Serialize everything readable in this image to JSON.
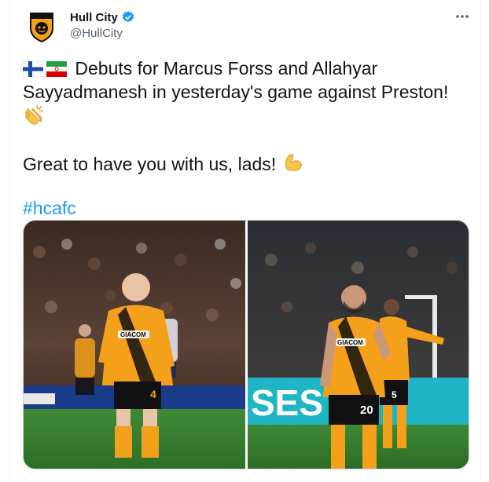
{
  "tweet": {
    "display_name": "Hull City",
    "handle": "@HullCity",
    "verified": true,
    "line1": " Debuts for Marcus Forss and Allahyar",
    "line2": "Sayyadmanesh in yesterday's game against Preston!",
    "line3": "Great to have you with us, lads! ",
    "hashtag": "#hcafc",
    "flags": [
      "flag-finland-icon",
      "flag-iran-icon"
    ],
    "emojis": [
      "clapping-hands-icon",
      "flexed-biceps-icon"
    ]
  },
  "media": {
    "photos": [
      {
        "shirt_sponsor": "GIACOM",
        "shirt_number": "4"
      },
      {
        "shirt_sponsor": "GIACOM",
        "shirt_number": "20",
        "background_player_number": "5",
        "board_text": "SES"
      }
    ]
  },
  "colors": {
    "accent": "#1d9bf0",
    "hull_amber": "#f5a01a",
    "text": "#0f1419",
    "secondary": "#536471"
  }
}
